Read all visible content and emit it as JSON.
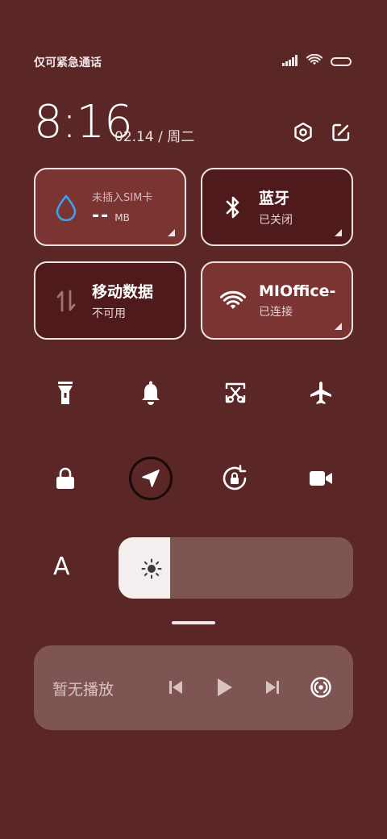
{
  "status_bar": {
    "carrier": "仅可紧急通话",
    "icons": [
      "signal-icon",
      "wifi-icon",
      "battery-icon"
    ]
  },
  "header": {
    "time": "8:16",
    "date": "02.14 / 周二",
    "icons": [
      "settings-icon",
      "edit-icon"
    ]
  },
  "tiles": {
    "data_usage": {
      "label": "未插入SIM卡",
      "value": "--",
      "unit": "MB",
      "icon": "water-drop-icon"
    },
    "bluetooth": {
      "title": "蓝牙",
      "status": "已关闭",
      "icon": "bluetooth-icon"
    },
    "mobile_data": {
      "title": "移动数据",
      "status": "不可用",
      "icon": "arrows-updown-icon"
    },
    "wifi": {
      "title": "MIOffice-",
      "status": "已连接",
      "icon": "wifi-icon"
    }
  },
  "toggles": [
    "flashlight-icon",
    "bell-icon",
    "screenshot-icon",
    "airplane-icon",
    "lock-icon",
    "location-icon",
    "rotation-lock-icon",
    "video-camera-icon"
  ],
  "brightness": {
    "auto_label": "A",
    "level": 0.22
  },
  "media": {
    "title": "暂无播放",
    "controls": [
      "previous-icon",
      "play-icon",
      "next-icon",
      "cast-icon"
    ]
  },
  "colors": {
    "background": "#5a2726",
    "tile_active": "#7a3432",
    "tile_inactive": "#4f1a1b",
    "panel": "#7e5553"
  }
}
